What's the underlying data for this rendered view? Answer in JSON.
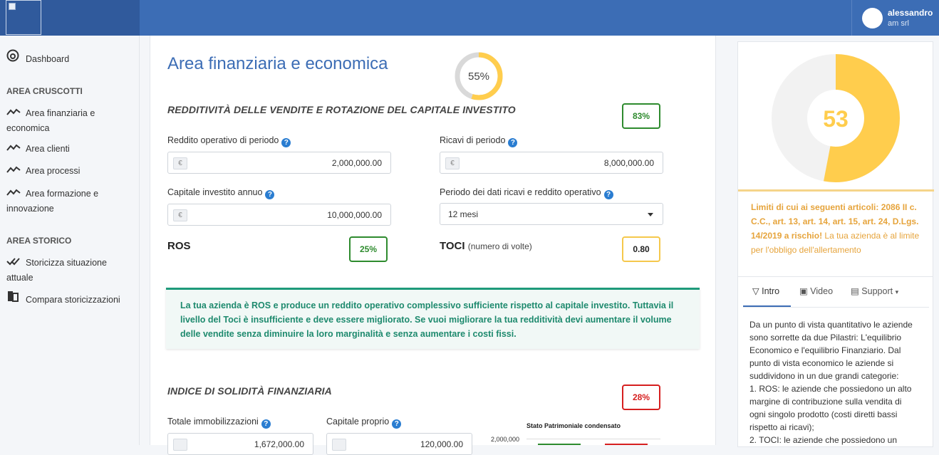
{
  "header": {
    "user_name": "alessandro",
    "company": "am srl"
  },
  "sidebar": {
    "dashboard": "Dashboard",
    "section1": "AREA CRUSCOTTI",
    "items1": [
      {
        "label1": "Area finanziaria e",
        "label2": "economica"
      },
      {
        "label1": "Area clienti"
      },
      {
        "label1": "Area processi"
      },
      {
        "label1": "Area formazione e",
        "label2": "innovazione"
      }
    ],
    "section2": "AREA STORICO",
    "items2": [
      {
        "label1": "Storicizza situazione",
        "label2": "attuale"
      },
      {
        "label1": "Compara storicizzazioni"
      }
    ]
  },
  "main": {
    "title": "Area finanziaria e economica",
    "overall_percent": "55%",
    "overall_value": 55,
    "section1": {
      "title": "REDDITIVITÀ DELLE VENDITE E ROTAZIONE DEL CAPITALE INVESTITO",
      "score": "83%",
      "reddito_label": "Reddito operativo di periodo",
      "reddito_value": "2,000,000.00",
      "ricavi_label": "Ricavi di periodo",
      "ricavi_value": "8,000,000.00",
      "capitale_label": "Capitale investito annuo",
      "capitale_value": "10,000,000.00",
      "periodo_label": "Periodo dei dati ricavi e reddito operativo",
      "periodo_value": "12 mesi",
      "ros_label": "ROS",
      "ros_value": "25%",
      "toci_label": "TOCI",
      "toci_sub": "(numero di volte)",
      "toci_value": "0.80",
      "currency": "€"
    },
    "alert": "La tua azienda è ROS e produce un reddito operativo complessivo sufficiente rispetto al capitale investito. Tuttavia il livello del Toci è insufficiente e deve essere migliorato. Se vuoi migliorare la tua redditività devi aumentare il volume delle vendite senza diminuire la loro marginalità e senza aumentare i costi fissi.",
    "section2": {
      "title": "INDICE DI SOLIDITÀ FINANZIARIA",
      "score": "28%",
      "immob_label": "Totale immobilizzazioni",
      "immob_value": "1,672,000.00",
      "capitale_label": "Capitale proprio",
      "capitale_value": "120,000.00",
      "chart_title": "Stato Patrimoniale condensato",
      "chart_tick": "2,000,000"
    }
  },
  "right": {
    "gauge_value": "53",
    "gauge_num": 53,
    "limit_bold": "Limiti di cui ai seguenti articoli: 2086 II c. C.C., art. 13, art. 14, art. 15, art. 24, D.Lgs. 14/2019 a rischio!",
    "limit_rest": " La tua azienda è al limite per l'obbligo dell'allertamento",
    "tabs": {
      "intro": "Intro",
      "video": "Video",
      "support": "Support"
    },
    "intro_lines": [
      "Da un punto di vista quantitativo le aziende",
      "sono sorrette da due Pilastri: L'equilibrio",
      "Economico e l'equilibrio Finanziario. Dal",
      "punto di vista economico le aziende si",
      "suddividono in un due grandi categorie:",
      "1. ROS: le aziende che possiedono un alto",
      "margine di contribuzione sulla vendita di",
      "ogni singolo prodotto (costi diretti bassi",
      "rispetto ai ricavi);",
      "2. TOCI: le aziende che possiedono un"
    ]
  },
  "colors": {
    "brand": "#3c6db5",
    "gauge": "#ffcd4d",
    "green": "#2e8b2e",
    "red": "#d61f1f"
  }
}
